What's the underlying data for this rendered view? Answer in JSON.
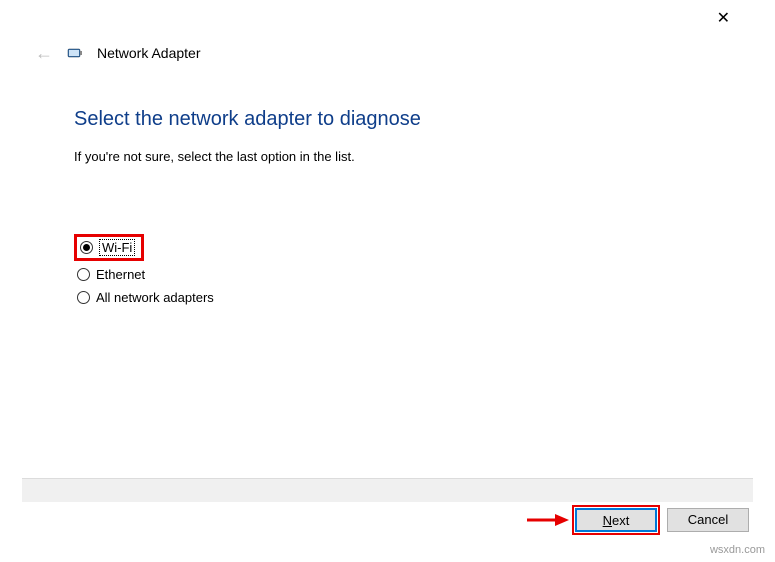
{
  "window": {
    "title": "Network Adapter"
  },
  "content": {
    "heading": "Select the network adapter to diagnose",
    "subtext": "If you're not sure, select the last option in the list."
  },
  "options": {
    "wifi": "Wi-Fi",
    "ethernet": "Ethernet",
    "all": "All network adapters"
  },
  "buttons": {
    "next": "Next",
    "cancel": "Cancel"
  },
  "watermark": "wsxdn.com"
}
